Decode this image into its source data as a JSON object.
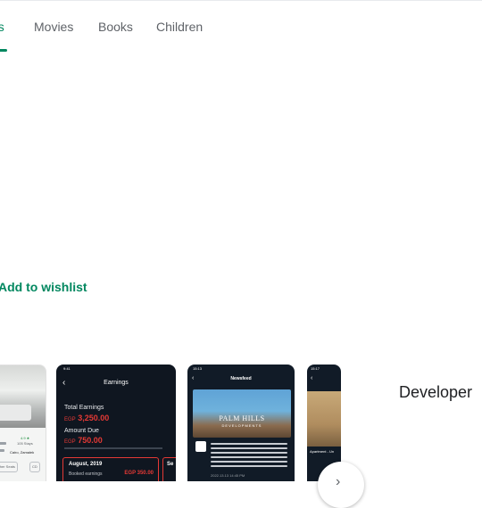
{
  "tabs": [
    {
      "label": "ps",
      "active": true
    },
    {
      "label": "Movies",
      "active": false
    },
    {
      "label": "Books",
      "active": false
    },
    {
      "label": "Children",
      "active": false
    }
  ],
  "wishlist": {
    "label": "Add to wishlist",
    "icon": "bookmark-add-icon"
  },
  "screenshots": {
    "listing": {
      "rating": "4.9 ★",
      "stays": "105 Stays",
      "location": "Cairo, Zamalek",
      "chips": [
        "Leather Seats",
        "CD"
      ]
    },
    "earnings": {
      "status_time": "9:41",
      "title": "Earnings",
      "total_label": "Total Earnings",
      "total_currency": "EGP",
      "total_value": "3,250.00",
      "due_label": "Amount Due",
      "due_currency": "EGP",
      "due_value": "750.00",
      "card_month": "August, 2019",
      "card_row_label": "Booked earnings",
      "card_row_value": "EGP 350.00",
      "card2_label": "Se"
    },
    "newsfeed": {
      "status_time": "15:13",
      "title": "Newsfeed",
      "brand": "PALM HILLS",
      "brand_sub": "DEVELOPMENTS",
      "timestamp": "2022.13.13 14:45 PM"
    },
    "partial": {
      "status_time": "15:17",
      "caption": "Apartment - Un"
    }
  },
  "next_button": {
    "icon": "chevron-right-icon"
  },
  "developer": {
    "title": "Developer"
  },
  "colors": {
    "accent": "#01875f",
    "earnings_red": "#e53935",
    "dark_bg": "#0f1620"
  }
}
